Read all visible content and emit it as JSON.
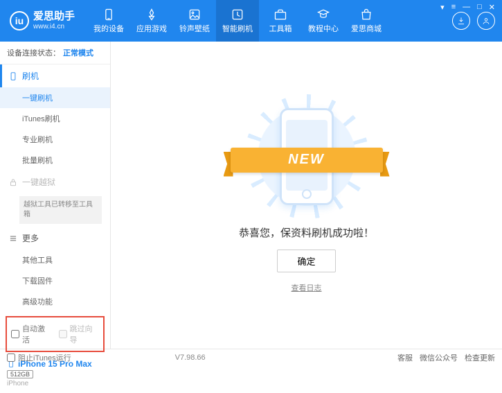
{
  "header": {
    "app_name": "爱思助手",
    "app_url": "www.i4.cn",
    "nav": [
      {
        "label": "我的设备"
      },
      {
        "label": "应用游戏"
      },
      {
        "label": "铃声壁纸"
      },
      {
        "label": "智能刷机"
      },
      {
        "label": "工具箱"
      },
      {
        "label": "教程中心"
      },
      {
        "label": "爱思商城"
      }
    ]
  },
  "sidebar": {
    "status_label": "设备连接状态：",
    "status_mode": "正常模式",
    "group_flash": "刷机",
    "items_flash": [
      "一键刷机",
      "iTunes刷机",
      "专业刷机",
      "批量刷机"
    ],
    "group_jailbreak": "一键越狱",
    "jailbreak_note": "越狱工具已转移至工具箱",
    "group_more": "更多",
    "items_more": [
      "其他工具",
      "下载固件",
      "高级功能"
    ],
    "chk_auto_activate": "自动激活",
    "chk_skip_setup": "跳过向导",
    "device_name": "iPhone 15 Pro Max",
    "device_storage": "512GB",
    "device_type": "iPhone"
  },
  "main": {
    "ribbon": "NEW",
    "success": "恭喜您，保资料刷机成功啦！",
    "ok": "确定",
    "view_log": "查看日志"
  },
  "footer": {
    "block_itunes": "阻止iTunes运行",
    "version": "V7.98.66",
    "links": [
      "客服",
      "微信公众号",
      "检查更新"
    ]
  }
}
